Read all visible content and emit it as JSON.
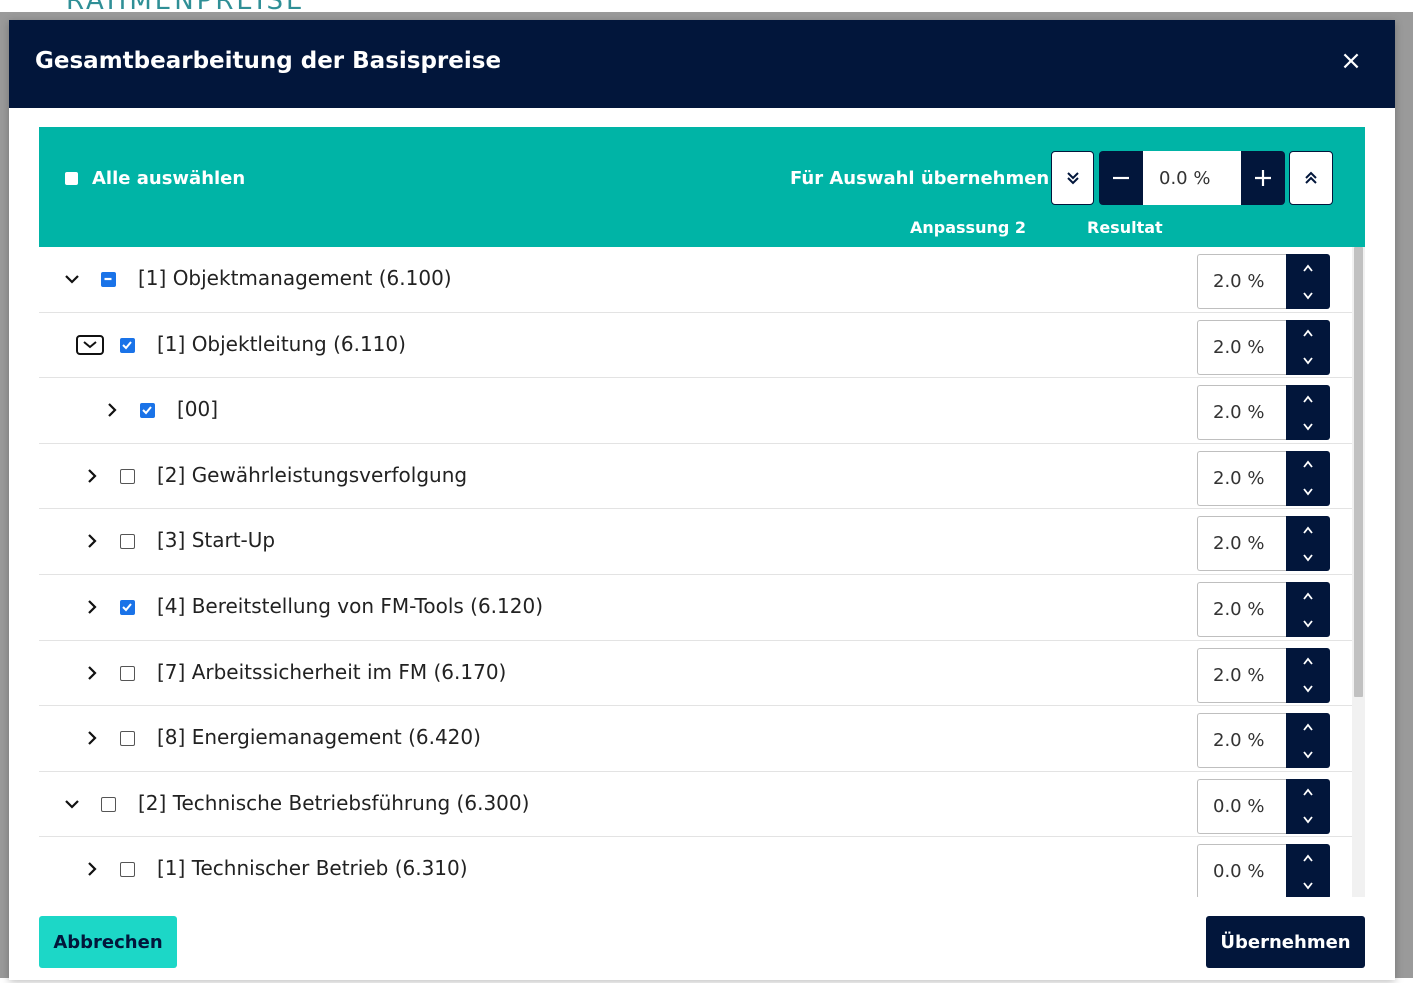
{
  "background": {
    "partial_heading": "RAHMENPREISE"
  },
  "modal": {
    "title": "Gesamtbearbeitung der Basispreise",
    "close_icon": "close-icon"
  },
  "toolbar": {
    "select_all_label": "Alle auswählen",
    "apply_to_selection_label": "Für Auswahl übernehmen",
    "adjust_value": "0.0 %",
    "col_adjustment": "Anpassung 2",
    "col_result": "Resultat"
  },
  "rows": [
    {
      "label": "[1] Objektmanagement (6.100)",
      "value": "2.0 %",
      "expanded": true,
      "check": "indeterminate",
      "level": 0
    },
    {
      "label": "[1] Objektleitung (6.110)",
      "value": "2.0 %",
      "expanded": true,
      "check": "checked",
      "level": 1
    },
    {
      "label": "[00]",
      "value": "2.0 %",
      "expanded": false,
      "check": "checked",
      "level": 2
    },
    {
      "label": "[2] Gewährleistungsverfolgung",
      "value": "2.0 %",
      "expanded": false,
      "check": "unchecked",
      "level": 1
    },
    {
      "label": "[3] Start-Up",
      "value": "2.0 %",
      "expanded": false,
      "check": "unchecked",
      "level": 1
    },
    {
      "label": "[4] Bereitstellung von FM-Tools (6.120)",
      "value": "2.0 %",
      "expanded": false,
      "check": "checked",
      "level": 1
    },
    {
      "label": "[7] Arbeitssicherheit im FM (6.170)",
      "value": "2.0 %",
      "expanded": false,
      "check": "unchecked",
      "level": 1
    },
    {
      "label": "[8] Energiemanagement (6.420)",
      "value": "2.0 %",
      "expanded": false,
      "check": "unchecked",
      "level": 1
    },
    {
      "label": "[2] Technische Betriebsführung (6.300)",
      "value": "0.0 %",
      "expanded": true,
      "check": "unchecked",
      "level": 0
    },
    {
      "label": "[1] Technischer Betrieb (6.310)",
      "value": "0.0 %",
      "expanded": false,
      "check": "unchecked",
      "level": 1
    }
  ],
  "footer": {
    "cancel_label": "Abbrechen",
    "apply_label": "Übernehmen"
  },
  "colors": {
    "header_bg": "#02163b",
    "toolbar_bg": "#00b4a6",
    "cancel_bg": "#1cd7c7",
    "checkbox_checked": "#1a73e8"
  }
}
